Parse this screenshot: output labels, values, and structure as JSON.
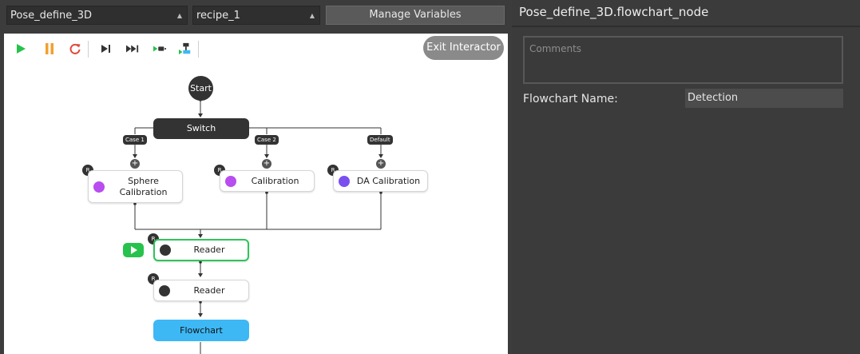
{
  "topbar": {
    "flow_select": "Pose_define_3D",
    "recipe_select": "recipe_1",
    "manage_variables": "Manage Variables"
  },
  "canvas": {
    "exit_interactor": "Exit Interactor",
    "start": "Start",
    "switch": "Switch",
    "cases": [
      "Case 1",
      "Case 2",
      "Default"
    ],
    "node1": "Sphere Calibration",
    "node2": "Calibration",
    "node3": "DA Calibration",
    "reader1": "Reader",
    "reader2": "Reader",
    "flowchart": "Flowchart",
    "badge": "R",
    "plus": "+"
  },
  "panel": {
    "title": "Pose_define_3D.flowchart_node",
    "comments_placeholder": "Comments",
    "flowchart_name_label": "Flowchart Name:",
    "flowchart_name_value": "Detection"
  },
  "colors": {
    "play": "#27c24c",
    "pause": "#f0a030",
    "reset": "#e04a3a",
    "active_border": "#2ec45a",
    "flowchart_node": "#3db8f5",
    "purple_icon": "#b84df0",
    "violet_icon": "#7a4ff0"
  }
}
